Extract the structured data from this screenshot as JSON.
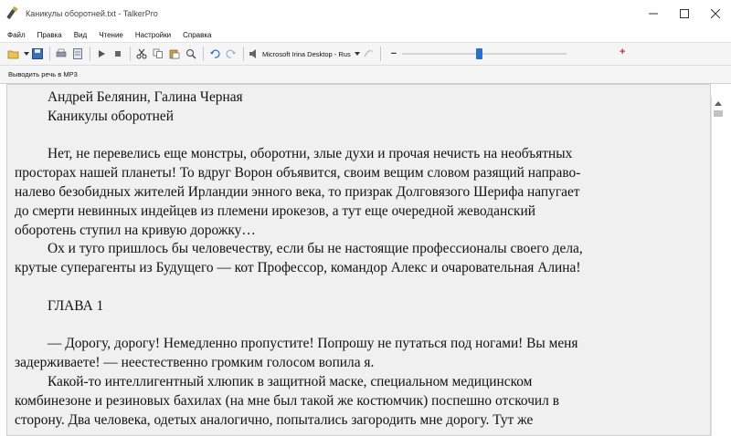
{
  "window": {
    "title": "Каникулы оборотней.txt - TalkerPro",
    "minimize_glyph": "—",
    "maximize_glyph": "☐",
    "close_glyph": "✕"
  },
  "menu": [
    {
      "label": "Файл"
    },
    {
      "label": "Правка"
    },
    {
      "label": "Вид"
    },
    {
      "label": "Чтение"
    },
    {
      "label": "Настройки"
    },
    {
      "label": "Справка"
    }
  ],
  "toolbar": {
    "icons": [
      "open-icon",
      "save-icon",
      "print-icon",
      "page-icon",
      "play-icon",
      "stop-icon",
      "cut-icon",
      "copy-icon",
      "paste-icon",
      "find-icon",
      "undo-icon",
      "redo-icon"
    ],
    "voice": "Microsoft Irina Desktop - Rus",
    "minus_glyph": "−",
    "plus_glyph": "+",
    "speed_level": 0.47
  },
  "toolbar2": {
    "mp3_label": "Выводить речь в MP3"
  },
  "document": {
    "lines": [
      "Андрей Белянин, Галина Черная",
      "Каникулы оборотней",
      "",
      "Нет, не перевелись еще монстры, оборотни, злые духи и прочая нечисть на необъятных",
      "просторах нашей планеты! То вдруг Ворон объявится, своим вещим словом разящий направо-",
      "налево безобидных жителей Ирландии энного века, то призрак Долговязого Шерифа напугает",
      "до смерти невинных индейцев из племени ирокезов, а тут еще очередной жеводанский",
      "оборотень ступил на кривую дорожку…",
      "Ох и туго пришлось бы человечеству, если бы не настоящие профессионалы своего дела,",
      "крутые суперагенты из Будущего — кот Профессор, командор Алекс и очаровательная Алина!",
      "",
      "ГЛАВА 1",
      "",
      "— Дорогу, дорогу! Немедленно пропустите! Попрошу не путаться под ногами! Вы меня",
      "задерживаете! — неестественно громким голосом вопила я.",
      "Какой-то интеллигентный хлюпик в защитной маске, специальном медицинском",
      "комбинезоне и резиновых бахилах (на мне был такой же костюмчик) поспешно отскочил в",
      "сторону. Два человека, одетых аналогично, попытались загородить мне дорогу. Тут же"
    ]
  }
}
